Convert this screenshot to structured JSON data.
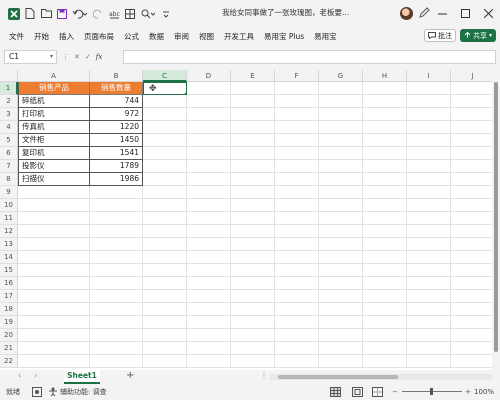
{
  "titlebar": {
    "title": "我给女同事做了一张玫瑰图，老板要..."
  },
  "menu": {
    "items": [
      "文件",
      "开始",
      "插入",
      "页面布局",
      "公式",
      "数据",
      "审阅",
      "视图",
      "开发工具",
      "易用宝 Plus",
      "易用宝"
    ],
    "comment_label": "批注",
    "share_label": "共享"
  },
  "formula_bar": {
    "name_box": "C1",
    "fx_label": "fx",
    "formula": ""
  },
  "grid": {
    "columns": [
      "A",
      "B",
      "C",
      "D",
      "E",
      "F",
      "G",
      "H",
      "I",
      "J"
    ],
    "rows": [
      "1",
      "2",
      "3",
      "4",
      "5",
      "6",
      "7",
      "8",
      "9",
      "10",
      "11",
      "12",
      "13",
      "14",
      "15",
      "16",
      "17",
      "18",
      "19",
      "20",
      "21",
      "22"
    ],
    "selected_column": "C",
    "selected_row": "1",
    "table": {
      "headers": [
        "销售产品",
        "销售数量"
      ],
      "data": [
        [
          "碎纸机",
          "744"
        ],
        [
          "打印机",
          "972"
        ],
        [
          "传真机",
          "1220"
        ],
        [
          "文件柜",
          "1450"
        ],
        [
          "复印机",
          "1541"
        ],
        [
          "投影仪",
          "1789"
        ],
        [
          "扫描仪",
          "1986"
        ]
      ],
      "header_color": "#ED7D31"
    },
    "accent_color": "#1E7145"
  },
  "sheet_tabs": {
    "active": "Sheet1",
    "add_label": "+"
  },
  "status_bar": {
    "ready": "就绪",
    "accessibility": "辅助功能: 调查",
    "zoom": "100%"
  }
}
